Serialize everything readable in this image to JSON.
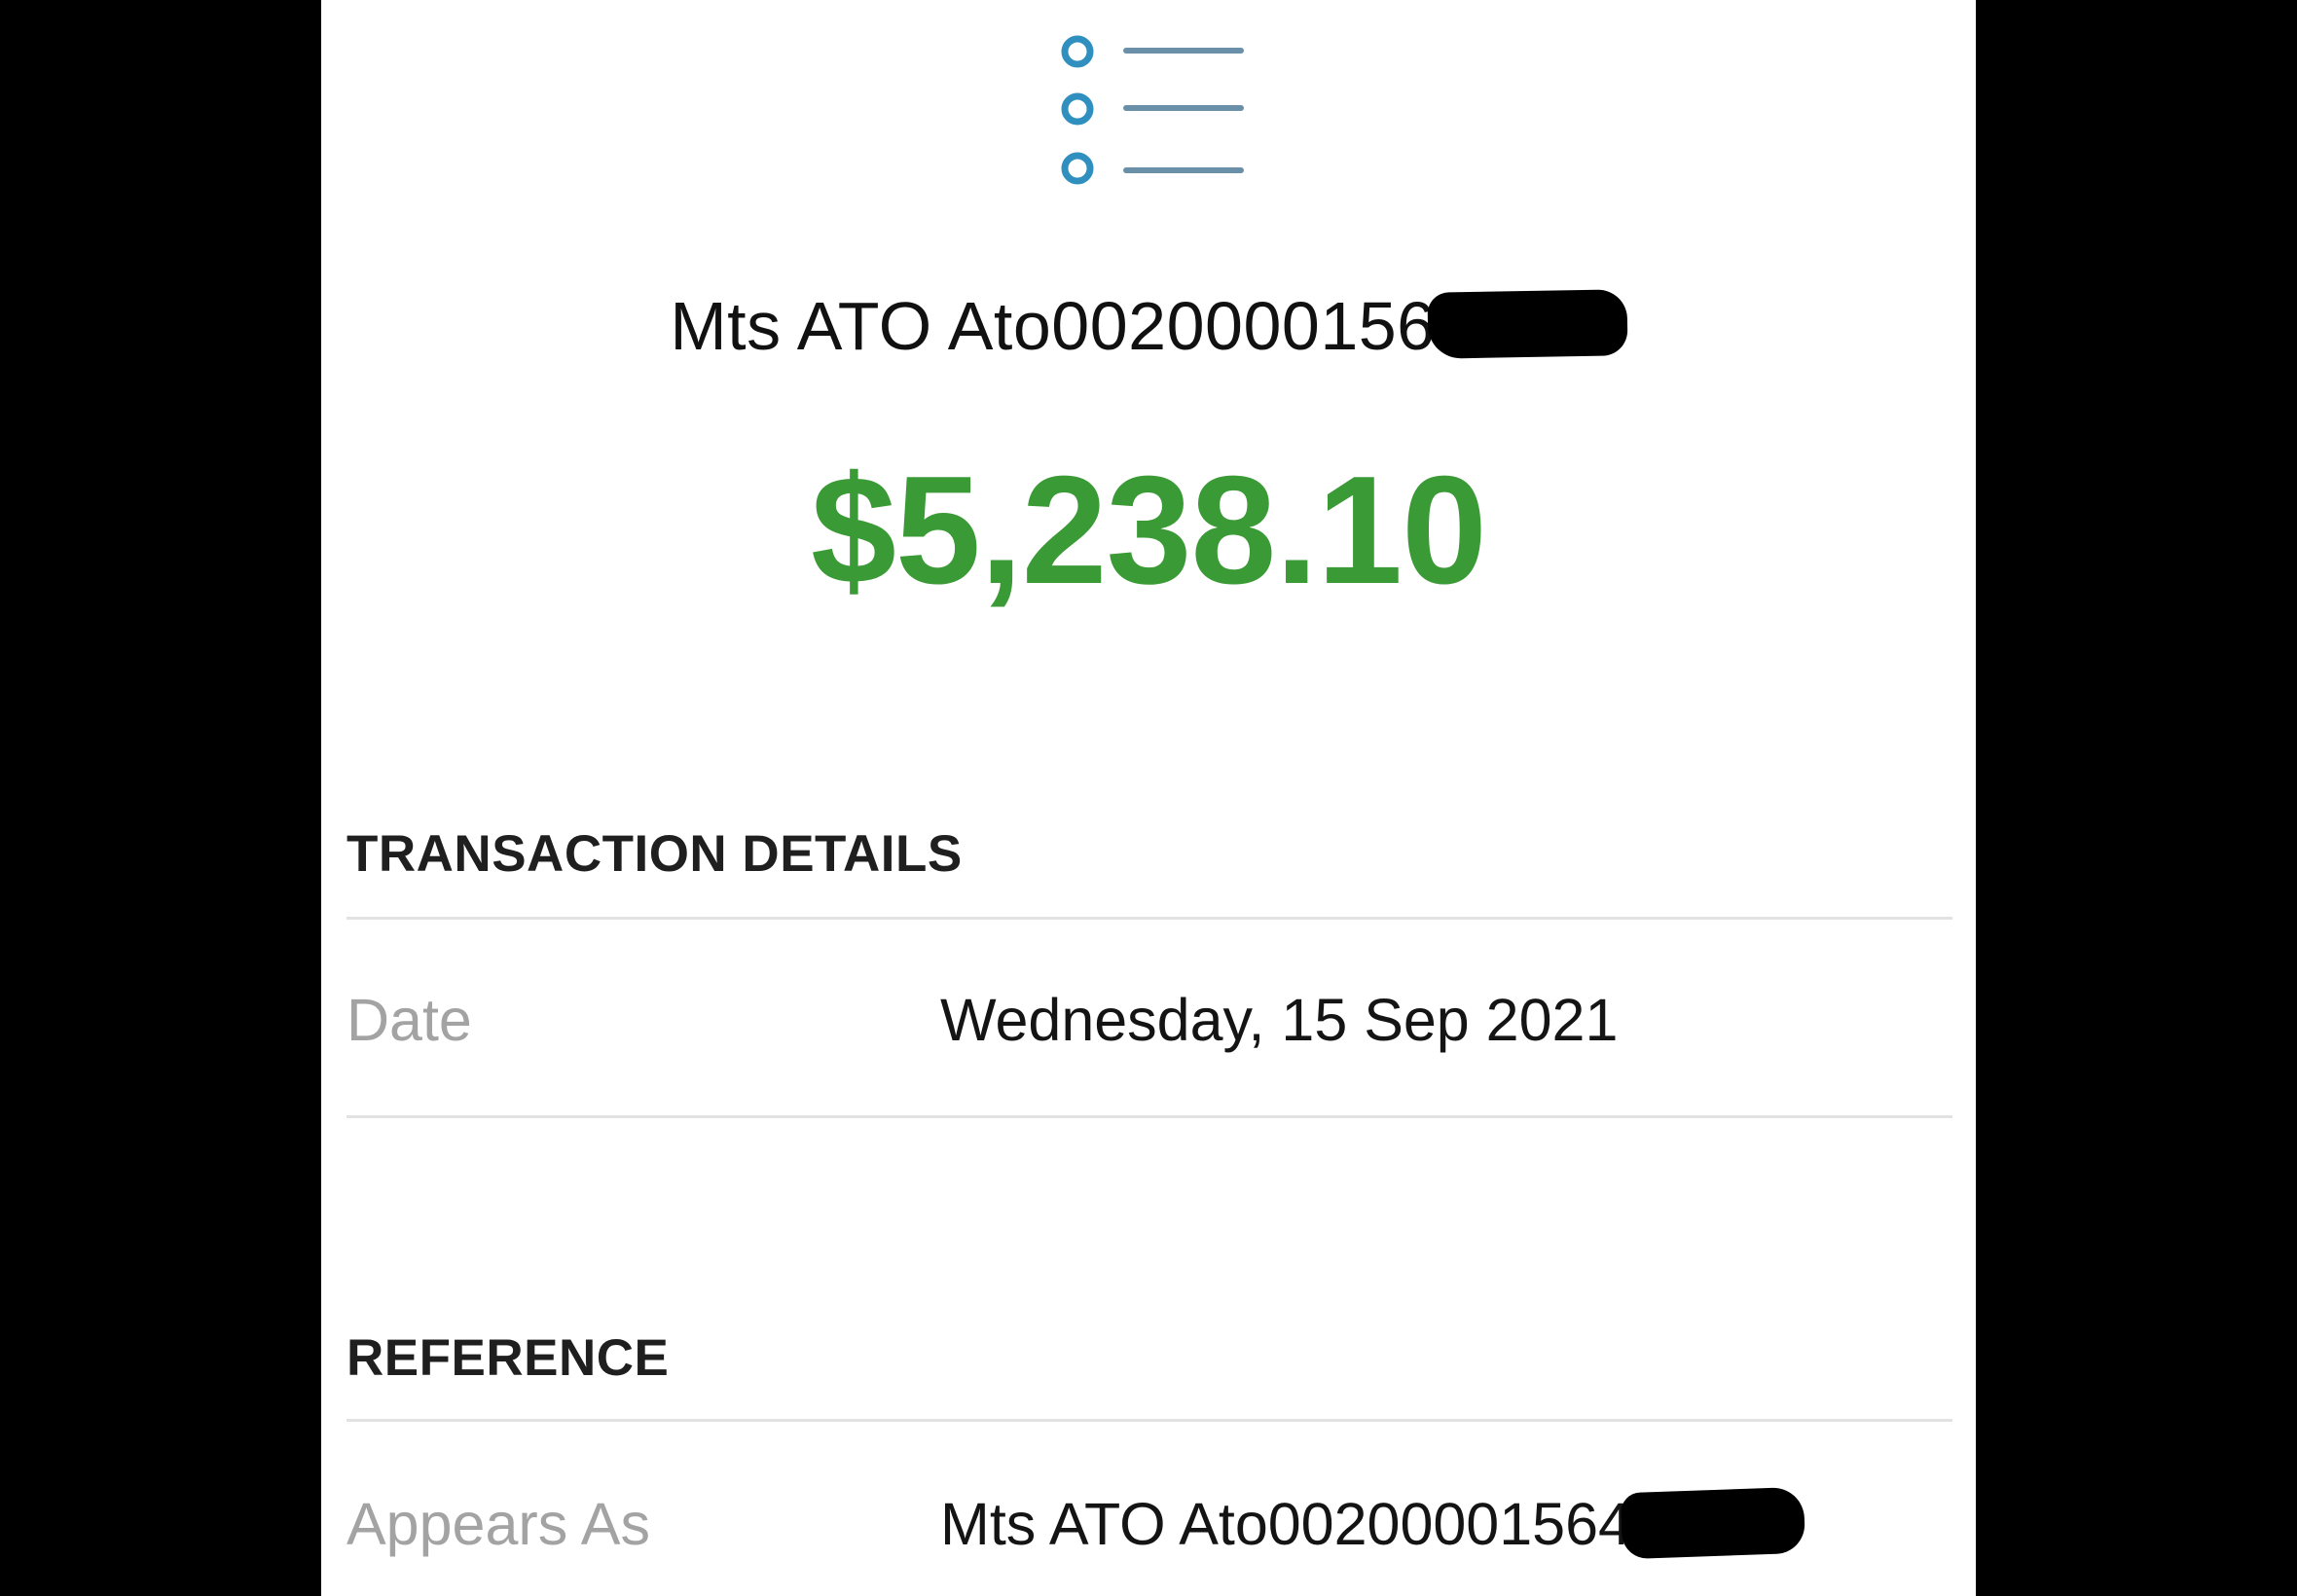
{
  "colors": {
    "amount": "#3a9a35",
    "icon_circle": "#2f8fbf",
    "icon_line": "#6a8fa8",
    "label": "#a3a3a3",
    "divider": "#e2e2e2"
  },
  "header": {
    "icon": "list-icon",
    "merchant": "Mts ATO Ato0020000156",
    "amount": "$5,238.10"
  },
  "transaction_details": {
    "title": "TRANSACTION DETAILS",
    "rows": [
      {
        "label": "Date",
        "value": "Wednesday, 15 Sep 2021"
      }
    ]
  },
  "reference": {
    "title": "REFERENCE",
    "rows": [
      {
        "label": "Appears As",
        "value": "Mts ATO Ato00200001564"
      }
    ]
  }
}
